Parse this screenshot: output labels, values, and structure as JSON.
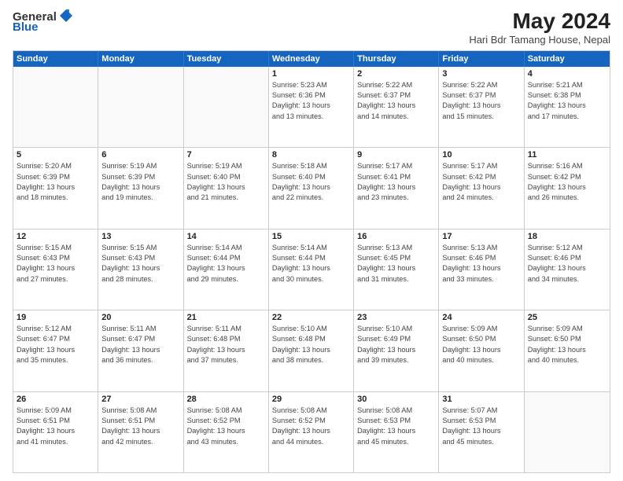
{
  "header": {
    "logo_general": "General",
    "logo_blue": "Blue",
    "month_year": "May 2024",
    "location": "Hari Bdr Tamang House, Nepal"
  },
  "weekdays": [
    "Sunday",
    "Monday",
    "Tuesday",
    "Wednesday",
    "Thursday",
    "Friday",
    "Saturday"
  ],
  "rows": [
    [
      {
        "day": "",
        "lines": [],
        "empty": true
      },
      {
        "day": "",
        "lines": [],
        "empty": true
      },
      {
        "day": "",
        "lines": [],
        "empty": true
      },
      {
        "day": "1",
        "lines": [
          "Sunrise: 5:23 AM",
          "Sunset: 6:36 PM",
          "Daylight: 13 hours",
          "and 13 minutes."
        ]
      },
      {
        "day": "2",
        "lines": [
          "Sunrise: 5:22 AM",
          "Sunset: 6:37 PM",
          "Daylight: 13 hours",
          "and 14 minutes."
        ]
      },
      {
        "day": "3",
        "lines": [
          "Sunrise: 5:22 AM",
          "Sunset: 6:37 PM",
          "Daylight: 13 hours",
          "and 15 minutes."
        ]
      },
      {
        "day": "4",
        "lines": [
          "Sunrise: 5:21 AM",
          "Sunset: 6:38 PM",
          "Daylight: 13 hours",
          "and 17 minutes."
        ]
      }
    ],
    [
      {
        "day": "5",
        "lines": [
          "Sunrise: 5:20 AM",
          "Sunset: 6:39 PM",
          "Daylight: 13 hours",
          "and 18 minutes."
        ]
      },
      {
        "day": "6",
        "lines": [
          "Sunrise: 5:19 AM",
          "Sunset: 6:39 PM",
          "Daylight: 13 hours",
          "and 19 minutes."
        ]
      },
      {
        "day": "7",
        "lines": [
          "Sunrise: 5:19 AM",
          "Sunset: 6:40 PM",
          "Daylight: 13 hours",
          "and 21 minutes."
        ]
      },
      {
        "day": "8",
        "lines": [
          "Sunrise: 5:18 AM",
          "Sunset: 6:40 PM",
          "Daylight: 13 hours",
          "and 22 minutes."
        ]
      },
      {
        "day": "9",
        "lines": [
          "Sunrise: 5:17 AM",
          "Sunset: 6:41 PM",
          "Daylight: 13 hours",
          "and 23 minutes."
        ]
      },
      {
        "day": "10",
        "lines": [
          "Sunrise: 5:17 AM",
          "Sunset: 6:42 PM",
          "Daylight: 13 hours",
          "and 24 minutes."
        ]
      },
      {
        "day": "11",
        "lines": [
          "Sunrise: 5:16 AM",
          "Sunset: 6:42 PM",
          "Daylight: 13 hours",
          "and 26 minutes."
        ]
      }
    ],
    [
      {
        "day": "12",
        "lines": [
          "Sunrise: 5:15 AM",
          "Sunset: 6:43 PM",
          "Daylight: 13 hours",
          "and 27 minutes."
        ]
      },
      {
        "day": "13",
        "lines": [
          "Sunrise: 5:15 AM",
          "Sunset: 6:43 PM",
          "Daylight: 13 hours",
          "and 28 minutes."
        ]
      },
      {
        "day": "14",
        "lines": [
          "Sunrise: 5:14 AM",
          "Sunset: 6:44 PM",
          "Daylight: 13 hours",
          "and 29 minutes."
        ]
      },
      {
        "day": "15",
        "lines": [
          "Sunrise: 5:14 AM",
          "Sunset: 6:44 PM",
          "Daylight: 13 hours",
          "and 30 minutes."
        ]
      },
      {
        "day": "16",
        "lines": [
          "Sunrise: 5:13 AM",
          "Sunset: 6:45 PM",
          "Daylight: 13 hours",
          "and 31 minutes."
        ]
      },
      {
        "day": "17",
        "lines": [
          "Sunrise: 5:13 AM",
          "Sunset: 6:46 PM",
          "Daylight: 13 hours",
          "and 33 minutes."
        ]
      },
      {
        "day": "18",
        "lines": [
          "Sunrise: 5:12 AM",
          "Sunset: 6:46 PM",
          "Daylight: 13 hours",
          "and 34 minutes."
        ]
      }
    ],
    [
      {
        "day": "19",
        "lines": [
          "Sunrise: 5:12 AM",
          "Sunset: 6:47 PM",
          "Daylight: 13 hours",
          "and 35 minutes."
        ]
      },
      {
        "day": "20",
        "lines": [
          "Sunrise: 5:11 AM",
          "Sunset: 6:47 PM",
          "Daylight: 13 hours",
          "and 36 minutes."
        ]
      },
      {
        "day": "21",
        "lines": [
          "Sunrise: 5:11 AM",
          "Sunset: 6:48 PM",
          "Daylight: 13 hours",
          "and 37 minutes."
        ]
      },
      {
        "day": "22",
        "lines": [
          "Sunrise: 5:10 AM",
          "Sunset: 6:48 PM",
          "Daylight: 13 hours",
          "and 38 minutes."
        ]
      },
      {
        "day": "23",
        "lines": [
          "Sunrise: 5:10 AM",
          "Sunset: 6:49 PM",
          "Daylight: 13 hours",
          "and 39 minutes."
        ]
      },
      {
        "day": "24",
        "lines": [
          "Sunrise: 5:09 AM",
          "Sunset: 6:50 PM",
          "Daylight: 13 hours",
          "and 40 minutes."
        ]
      },
      {
        "day": "25",
        "lines": [
          "Sunrise: 5:09 AM",
          "Sunset: 6:50 PM",
          "Daylight: 13 hours",
          "and 40 minutes."
        ]
      }
    ],
    [
      {
        "day": "26",
        "lines": [
          "Sunrise: 5:09 AM",
          "Sunset: 6:51 PM",
          "Daylight: 13 hours",
          "and 41 minutes."
        ]
      },
      {
        "day": "27",
        "lines": [
          "Sunrise: 5:08 AM",
          "Sunset: 6:51 PM",
          "Daylight: 13 hours",
          "and 42 minutes."
        ]
      },
      {
        "day": "28",
        "lines": [
          "Sunrise: 5:08 AM",
          "Sunset: 6:52 PM",
          "Daylight: 13 hours",
          "and 43 minutes."
        ]
      },
      {
        "day": "29",
        "lines": [
          "Sunrise: 5:08 AM",
          "Sunset: 6:52 PM",
          "Daylight: 13 hours",
          "and 44 minutes."
        ]
      },
      {
        "day": "30",
        "lines": [
          "Sunrise: 5:08 AM",
          "Sunset: 6:53 PM",
          "Daylight: 13 hours",
          "and 45 minutes."
        ]
      },
      {
        "day": "31",
        "lines": [
          "Sunrise: 5:07 AM",
          "Sunset: 6:53 PM",
          "Daylight: 13 hours",
          "and 45 minutes."
        ]
      },
      {
        "day": "",
        "lines": [],
        "empty": true
      }
    ]
  ]
}
